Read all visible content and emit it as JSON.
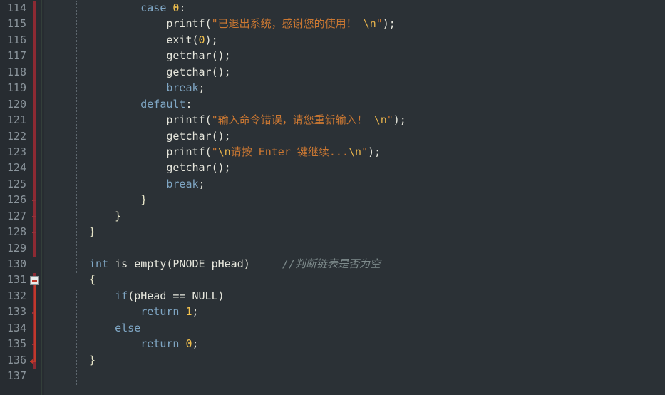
{
  "editor": {
    "title": "Code Editor",
    "language": "C",
    "theme": "Darcula",
    "colors": {
      "background": "#2b3136",
      "gutter_background": "#272c31",
      "line_number": "#8b959c",
      "keyword": "#7fa6c4",
      "number": "#f2c14e",
      "string": "#cc7832",
      "escape": "#e3b04b",
      "comment": "#7f8c8d",
      "text": "#e6e6dc",
      "changebar": "#8c2a33",
      "fold_marker": "#c0392b"
    },
    "first_line_number": 114,
    "last_line_number": 137,
    "line_numbers": [
      "114",
      "115",
      "116",
      "117",
      "118",
      "119",
      "120",
      "121",
      "122",
      "123",
      "124",
      "125",
      "126",
      "127",
      "128",
      "129",
      "130",
      "131",
      "132",
      "133",
      "134",
      "135",
      "136",
      "137"
    ],
    "fold_marker": {
      "line": "131",
      "state": "expanded",
      "icon": "minus-square-icon",
      "end_line": "136"
    },
    "lines": [
      {
        "n": "114",
        "indent": 8,
        "tokens": [
          {
            "t": "case",
            "c": "kw"
          },
          {
            "t": " ",
            "c": "punc"
          },
          {
            "t": "0",
            "c": "num"
          },
          {
            "t": ":",
            "c": "punc"
          }
        ]
      },
      {
        "n": "115",
        "indent": 12,
        "tokens": [
          {
            "t": "printf",
            "c": "fn"
          },
          {
            "t": "(",
            "c": "punc"
          },
          {
            "t": "\"已退出系统，感谢您的使用！ ",
            "c": "str"
          },
          {
            "t": "\\n",
            "c": "esc"
          },
          {
            "t": "\"",
            "c": "str"
          },
          {
            "t": ");",
            "c": "punc"
          }
        ]
      },
      {
        "n": "116",
        "indent": 12,
        "tokens": [
          {
            "t": "exit",
            "c": "fn"
          },
          {
            "t": "(",
            "c": "punc"
          },
          {
            "t": "0",
            "c": "num"
          },
          {
            "t": ");",
            "c": "punc"
          }
        ]
      },
      {
        "n": "117",
        "indent": 12,
        "tokens": [
          {
            "t": "getchar",
            "c": "fn"
          },
          {
            "t": "();",
            "c": "punc"
          }
        ]
      },
      {
        "n": "118",
        "indent": 12,
        "tokens": [
          {
            "t": "getchar",
            "c": "fn"
          },
          {
            "t": "();",
            "c": "punc"
          }
        ]
      },
      {
        "n": "119",
        "indent": 12,
        "tokens": [
          {
            "t": "break",
            "c": "kw"
          },
          {
            "t": ";",
            "c": "punc"
          }
        ]
      },
      {
        "n": "120",
        "indent": 8,
        "tokens": [
          {
            "t": "default",
            "c": "kw"
          },
          {
            "t": ":",
            "c": "punc"
          }
        ]
      },
      {
        "n": "121",
        "indent": 12,
        "tokens": [
          {
            "t": "printf",
            "c": "fn"
          },
          {
            "t": "(",
            "c": "punc"
          },
          {
            "t": "\"输入命令错误，请您重新输入！ ",
            "c": "str"
          },
          {
            "t": "\\n",
            "c": "esc"
          },
          {
            "t": "\"",
            "c": "str"
          },
          {
            "t": ");",
            "c": "punc"
          }
        ]
      },
      {
        "n": "122",
        "indent": 12,
        "tokens": [
          {
            "t": "getchar",
            "c": "fn"
          },
          {
            "t": "();",
            "c": "punc"
          }
        ]
      },
      {
        "n": "123",
        "indent": 12,
        "tokens": [
          {
            "t": "printf",
            "c": "fn"
          },
          {
            "t": "(",
            "c": "punc"
          },
          {
            "t": "\"",
            "c": "str"
          },
          {
            "t": "\\n",
            "c": "esc"
          },
          {
            "t": "请按 Enter 键继续...",
            "c": "str"
          },
          {
            "t": "\\n",
            "c": "esc"
          },
          {
            "t": "\"",
            "c": "str"
          },
          {
            "t": ");",
            "c": "punc"
          }
        ]
      },
      {
        "n": "124",
        "indent": 12,
        "tokens": [
          {
            "t": "getchar",
            "c": "fn"
          },
          {
            "t": "();",
            "c": "punc"
          }
        ]
      },
      {
        "n": "125",
        "indent": 12,
        "tokens": [
          {
            "t": "break",
            "c": "kw"
          },
          {
            "t": ";",
            "c": "punc"
          }
        ]
      },
      {
        "n": "126",
        "indent": 8,
        "tokens": [
          {
            "t": "}",
            "c": "brace"
          }
        ]
      },
      {
        "n": "127",
        "indent": 4,
        "tokens": [
          {
            "t": "}",
            "c": "brace"
          }
        ]
      },
      {
        "n": "128",
        "indent": 0,
        "tokens": [
          {
            "t": "}",
            "c": "brace"
          }
        ]
      },
      {
        "n": "129",
        "indent": 0,
        "tokens": []
      },
      {
        "n": "130",
        "indent": 0,
        "tokens": [
          {
            "t": "int",
            "c": "kw"
          },
          {
            "t": " ",
            "c": "punc"
          },
          {
            "t": "is_empty",
            "c": "fn"
          },
          {
            "t": "(",
            "c": "punc"
          },
          {
            "t": "PNODE pHead",
            "c": "fn"
          },
          {
            "t": ")",
            "c": "punc"
          },
          {
            "t": "     ",
            "c": "punc"
          },
          {
            "t": "//判断链表是否为空",
            "c": "cmt"
          }
        ]
      },
      {
        "n": "131",
        "indent": 0,
        "tokens": [
          {
            "t": "{",
            "c": "brace"
          }
        ]
      },
      {
        "n": "132",
        "indent": 4,
        "tokens": [
          {
            "t": "if",
            "c": "kw"
          },
          {
            "t": "(",
            "c": "punc"
          },
          {
            "t": "pHead",
            "c": "fn"
          },
          {
            "t": " == ",
            "c": "punc"
          },
          {
            "t": "NULL",
            "c": "fn"
          },
          {
            "t": ")",
            "c": "punc"
          }
        ]
      },
      {
        "n": "133",
        "indent": 8,
        "tokens": [
          {
            "t": "return",
            "c": "kw"
          },
          {
            "t": " ",
            "c": "punc"
          },
          {
            "t": "1",
            "c": "num"
          },
          {
            "t": ";",
            "c": "punc"
          }
        ]
      },
      {
        "n": "134",
        "indent": 4,
        "tokens": [
          {
            "t": "else",
            "c": "kw"
          }
        ]
      },
      {
        "n": "135",
        "indent": 8,
        "tokens": [
          {
            "t": "return",
            "c": "kw"
          },
          {
            "t": " ",
            "c": "punc"
          },
          {
            "t": "0",
            "c": "num"
          },
          {
            "t": ";",
            "c": "punc"
          }
        ]
      },
      {
        "n": "136",
        "indent": 0,
        "tokens": [
          {
            "t": "}",
            "c": "brace"
          }
        ]
      },
      {
        "n": "137",
        "indent": 0,
        "tokens": []
      }
    ],
    "indent_guides": [
      {
        "col": 4,
        "from_line": 0,
        "to_line": 16
      },
      {
        "col": 8,
        "from_line": 0,
        "to_line": 12
      },
      {
        "col": 4,
        "from_line": 18,
        "to_line": 23
      },
      {
        "col": 8,
        "from_line": 18,
        "to_line": 23
      }
    ],
    "changebars": [
      {
        "from_line": 0,
        "to_line": 15
      },
      {
        "from_line": 17,
        "to_line": 22
      }
    ]
  }
}
